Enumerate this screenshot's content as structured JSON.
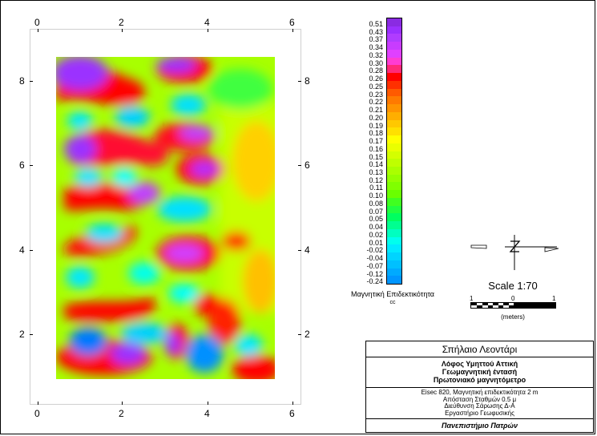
{
  "map": {
    "x_ticks": [
      "0",
      "2",
      "4",
      "6"
    ],
    "y_ticks": [
      "2",
      "4",
      "6",
      "8"
    ]
  },
  "colorbar": {
    "labels": [
      "0.51",
      "0.43",
      "0.37",
      "0.34",
      "0.32",
      "0.30",
      "0.28",
      "0.26",
      "0.25",
      "0.23",
      "0.22",
      "0.21",
      "0.20",
      "0.19",
      "0.18",
      "0.17",
      "0.16",
      "0.15",
      "0.14",
      "0.13",
      "0.12",
      "0.11",
      "0.10",
      "0.08",
      "0.07",
      "0.05",
      "0.04",
      "0.02",
      "0.01",
      "-0.02",
      "-0.04",
      "-0.07",
      "-0.12",
      "-0.24"
    ],
    "colors": [
      "#8a2be2",
      "#9b30ff",
      "#b03cff",
      "#c83cff",
      "#e040ff",
      "#ff3cd2",
      "#ff2a78",
      "#ff0000",
      "#ff3000",
      "#ff5a00",
      "#ff7a00",
      "#ff9400",
      "#ffae00",
      "#ffc800",
      "#ffe000",
      "#ffff00",
      "#eaff00",
      "#d4ff00",
      "#bfff00",
      "#aaff00",
      "#95ff00",
      "#80ff00",
      "#6aff00",
      "#40ff20",
      "#20ff40",
      "#00ff60",
      "#00ff90",
      "#00ffc0",
      "#00ffee",
      "#00eaff",
      "#00d4ff",
      "#00c0ff",
      "#00aaff",
      "#0096ff"
    ],
    "title": "Μαγνητική Επιδεκτικότητα",
    "unit": "cc"
  },
  "scale": {
    "text": "Scale 1:70",
    "left_label": "1",
    "mid_label": "0",
    "right_label": "1",
    "units": "(meters)"
  },
  "title_block": {
    "title": "Σπήλαιο Λεοντάρι",
    "subtitle_lines": [
      "Λόφος Υμηττού Αττική",
      "Γεωμαγνητική έντασή",
      "Πρωτονιακό μαγνητόμετρο"
    ],
    "info_lines": [
      "Eisec 820, Μαγνητική επιδεκτικότητα 2 m",
      "Απόσταση Σταθμών 0.5 μ",
      "Διεύθυνση Σάρωσης Δ-Α",
      "Εργαστήριο Γεωφυσικής"
    ],
    "institution": "Πανεπιστήμιο Πατρών"
  }
}
